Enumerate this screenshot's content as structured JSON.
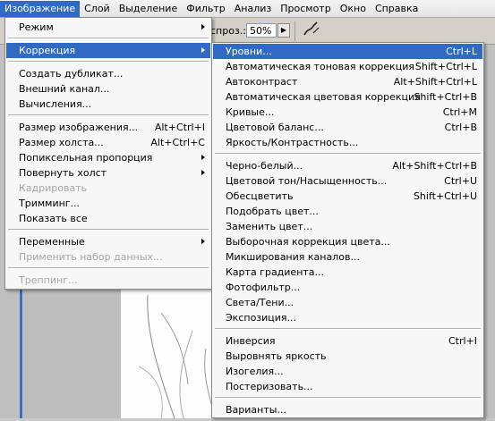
{
  "menubar": {
    "items": [
      {
        "label": "Изображение",
        "active": true
      },
      {
        "label": "Слой"
      },
      {
        "label": "Выделение"
      },
      {
        "label": "Фильтр"
      },
      {
        "label": "Анализ"
      },
      {
        "label": "Просмотр"
      },
      {
        "label": "Окно"
      },
      {
        "label": "Справка"
      }
    ]
  },
  "options_bar": {
    "label": "спроз.:",
    "value": "50%",
    "brush_icon": "airbrush-icon"
  },
  "image_menu": {
    "items": [
      {
        "label": "Режим",
        "submenu": true
      },
      {
        "separator": true
      },
      {
        "label": "Коррекция",
        "submenu": true,
        "highlighted": true
      },
      {
        "separator": true
      },
      {
        "label": "Создать дубликат..."
      },
      {
        "label": "Внешний канал..."
      },
      {
        "label": "Вычисления..."
      },
      {
        "separator": true
      },
      {
        "label": "Размер изображения...",
        "shortcut": "Alt+Ctrl+I"
      },
      {
        "label": "Размер холста...",
        "shortcut": "Alt+Ctrl+C"
      },
      {
        "label": "Попиксельная пропорция",
        "submenu": true
      },
      {
        "label": "Повернуть холст",
        "submenu": true
      },
      {
        "label": "Кадрировать",
        "disabled": true
      },
      {
        "label": "Тримминг..."
      },
      {
        "label": "Показать все"
      },
      {
        "separator": true
      },
      {
        "label": "Переменные",
        "submenu": true
      },
      {
        "label": "Применить набор данных...",
        "disabled": true
      },
      {
        "separator": true
      },
      {
        "label": "Треппинг...",
        "disabled": true
      }
    ]
  },
  "adjust_menu": {
    "items": [
      {
        "label": "Уровни...",
        "shortcut": "Ctrl+L",
        "highlighted": true
      },
      {
        "label": "Автоматическая тоновая коррекция",
        "shortcut": "Shift+Ctrl+L"
      },
      {
        "label": "Автоконтраст",
        "shortcut": "Alt+Shift+Ctrl+L"
      },
      {
        "label": "Автоматическая цветовая коррекция",
        "shortcut": "Shift+Ctrl+B"
      },
      {
        "label": "Кривые...",
        "shortcut": "Ctrl+M"
      },
      {
        "label": "Цветовой баланс...",
        "shortcut": "Ctrl+B"
      },
      {
        "label": "Яркость/Контрастность..."
      },
      {
        "separator": true
      },
      {
        "label": "Черно-белый...",
        "shortcut": "Alt+Shift+Ctrl+B"
      },
      {
        "label": "Цветовой тон/Насыщенность...",
        "shortcut": "Ctrl+U"
      },
      {
        "label": "Обесцветить",
        "shortcut": "Shift+Ctrl+U"
      },
      {
        "label": "Подобрать цвет..."
      },
      {
        "label": "Заменить цвет..."
      },
      {
        "label": "Выборочная коррекция цвета..."
      },
      {
        "label": "Микширования каналов..."
      },
      {
        "label": "Карта градиента..."
      },
      {
        "label": "Фотофильтр..."
      },
      {
        "label": "Света/Тени..."
      },
      {
        "label": "Экспозиция..."
      },
      {
        "separator": true
      },
      {
        "label": "Инверсия",
        "shortcut": "Ctrl+I"
      },
      {
        "label": "Выровнять яркость"
      },
      {
        "label": "Изогелия..."
      },
      {
        "label": "Постеризовать..."
      },
      {
        "separator": true
      },
      {
        "label": "Варианты..."
      }
    ]
  }
}
